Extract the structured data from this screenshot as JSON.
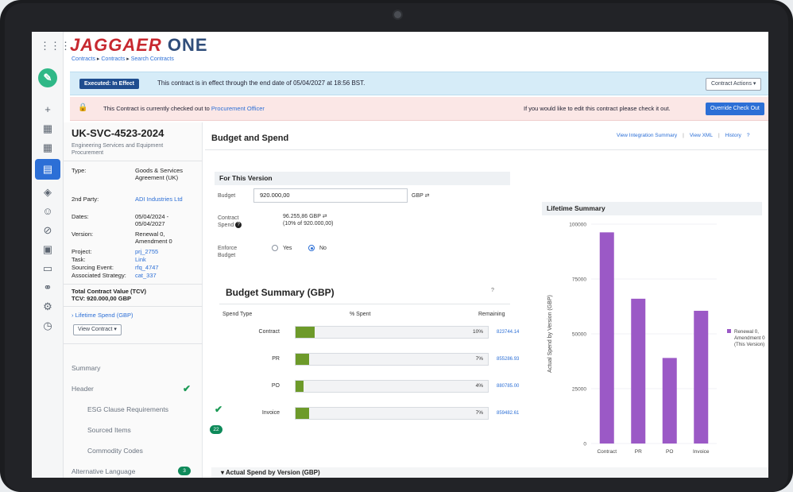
{
  "app": {
    "brand_part1": "JAGGAER",
    "brand_part2": "ONE",
    "breadcrumb": [
      "Contracts",
      "Contracts",
      "Search Contracts"
    ]
  },
  "banner_effect": {
    "badge": "Executed: In Effect",
    "text": "This contract is in effect through the end date of 05/04/2027 at 18:56 BST.",
    "actions_button": "Contract Actions"
  },
  "banner_checkout": {
    "text": "This Contract is currently checked out to",
    "owner": "Procurement Officer",
    "right_text": "If you would like to edit this contract please check it out.",
    "button": "Override Check Out"
  },
  "sidebar": {
    "contract_id": "UK-SVC-4523-2024",
    "contract_desc": "Engineering Services and Equipment Procurement",
    "meta": [
      {
        "key": "Type:",
        "value": "Goods & Services Agreement (UK)",
        "link": false
      },
      {
        "key": "2nd Party:",
        "value": "ADI Industries Ltd",
        "link": true
      },
      {
        "key": "Dates:",
        "value": "05/04/2024 - 05/04/2027",
        "link": false
      },
      {
        "key": "Version:",
        "value": "Renewal 0, Amendment 0",
        "link": false
      },
      {
        "key": "Project:",
        "value": "prj_2755",
        "link": true
      },
      {
        "key": "Task:",
        "value": "Link",
        "link": true
      },
      {
        "key": "Sourcing Event:",
        "value": "rfq_4747",
        "link": true
      },
      {
        "key": "Associated Strategy:",
        "value": "cat_337",
        "link": true
      }
    ],
    "tcv_label": "Total Contract Value (TCV)",
    "tcv_value": "TCV:  920.000,00 GBP",
    "lifetime_link": "Lifetime Spend (GBP)",
    "view_contract": "View Contract",
    "nav": [
      {
        "label": "Summary",
        "sub": false,
        "check": false,
        "badge": ""
      },
      {
        "label": "Header",
        "sub": false,
        "check": true,
        "badge": ""
      },
      {
        "label": "ESG Clause Requirements",
        "sub": true,
        "check": true,
        "badge": ""
      },
      {
        "label": "Sourced Items",
        "sub": true,
        "check": false,
        "badge": "22"
      },
      {
        "label": "Commodity Codes",
        "sub": true,
        "check": false,
        "badge": ""
      },
      {
        "label": "Alternative Language",
        "sub": false,
        "check": false,
        "badge": "3"
      }
    ]
  },
  "main": {
    "title": "Budget and Spend",
    "links": [
      "View Integration Summary",
      "View XML",
      "History"
    ],
    "version_section": "For This Version",
    "budget_label": "Budget",
    "budget_value": "920.000,00",
    "budget_currency": "GBP",
    "spend_label": "Contract Spend",
    "spend_value": "96.255,86 GBP",
    "spend_note": "(10% of 920.000,00)",
    "enforce_label": "Enforce Budget",
    "yes_label": "Yes",
    "no_label": "No",
    "enforce_selected": "No",
    "budget_summary_title": "Budget Summary (GBP)",
    "cols": [
      "Spend Type",
      "% Spent",
      "Remaining"
    ],
    "rows": [
      {
        "type": "Contract",
        "pct_label": "10%",
        "pct": 0.1,
        "remaining": "823744.14"
      },
      {
        "type": "PR",
        "pct_label": "7%",
        "pct": 0.07,
        "remaining": "855286.93"
      },
      {
        "type": "PO",
        "pct_label": "4%",
        "pct": 0.04,
        "remaining": "880785.00"
      },
      {
        "type": "Invoice",
        "pct_label": "7%",
        "pct": 0.07,
        "remaining": "859482.61"
      }
    ],
    "lifetime_title": "Lifetime Summary",
    "bottom_section": "Actual Spend by Version (GBP)"
  },
  "chart_data": {
    "type": "bar",
    "categories": [
      "Contract",
      "PR",
      "PO",
      "Invoice"
    ],
    "series": [
      {
        "name": "Renewal 0, Amendment 0 (This Version)",
        "values": [
          96255.86,
          66000,
          39000,
          60500
        ]
      }
    ],
    "ylabel": "Actual Spend by Version (GBP)",
    "yticks": [
      "0",
      "25000",
      "50000",
      "75000",
      "100000"
    ],
    "ylim": [
      0,
      100000
    ],
    "legend": "right",
    "color": "#9b59c6"
  }
}
